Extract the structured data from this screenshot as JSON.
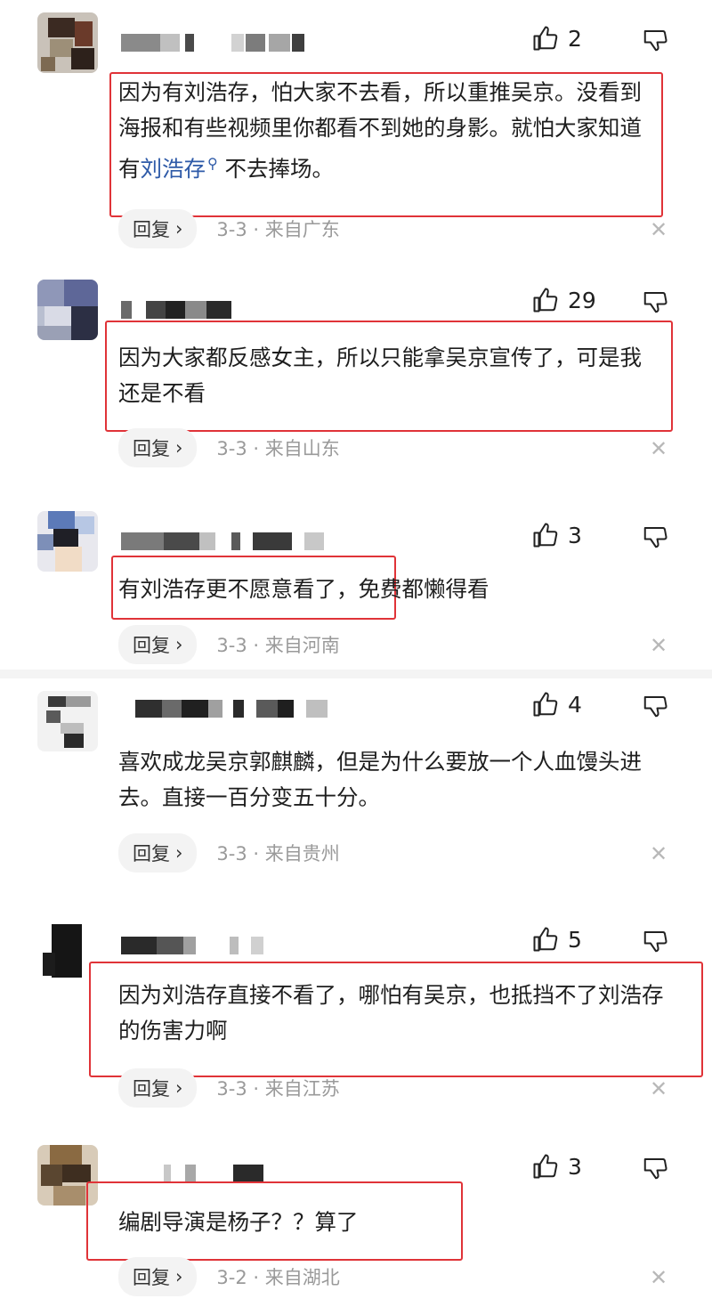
{
  "comments": [
    {
      "likes": "2",
      "text": "因为有刘浩存，怕大家不去看，所以重推吴京。没看到海报和有些视频里你都看不到她的身影。就怕大家知道有",
      "tag": "刘浩存",
      "text_after": " 不去捧场。",
      "reply_label": "回复",
      "info": "3-3 · 来自广东"
    },
    {
      "likes": "29",
      "text": "因为大家都反感女主，所以只能拿吴京宣传了，可是我还是不看",
      "reply_label": "回复",
      "info": "3-3 · 来自山东"
    },
    {
      "likes": "3",
      "text": "有刘浩存更不愿意看了，免费都懒得看",
      "reply_label": "回复",
      "info": "3-3 · 来自河南"
    },
    {
      "likes": "4",
      "text": "喜欢成龙吴京郭麒麟，但是为什么要放一个人血馒头进去。直接一百分变五十分。",
      "reply_label": "回复",
      "info": "3-3 · 来自贵州"
    },
    {
      "likes": "5",
      "text": "因为刘浩存直接不看了，哪怕有吴京，也抵挡不了刘浩存的伤害力啊",
      "reply_label": "回复",
      "info": "3-3 · 来自江苏"
    },
    {
      "likes": "3",
      "text": "编剧导演是杨子？？算了",
      "reply_label": "回复",
      "info": "3-2 · 来自湖北"
    }
  ],
  "icons": {
    "like": "thumbs-up-icon",
    "dislike": "thumbs-down-icon",
    "chevron": "chevron-right-icon",
    "close": "close-icon",
    "tag": "search-icon"
  },
  "colors": {
    "highlight_box": "#e03338",
    "tag_link": "#2e5aa8",
    "meta_text": "#9a9a9a"
  },
  "glyphs": {
    "chevron": "›",
    "close": "✕",
    "tag_icon": "⚲"
  }
}
